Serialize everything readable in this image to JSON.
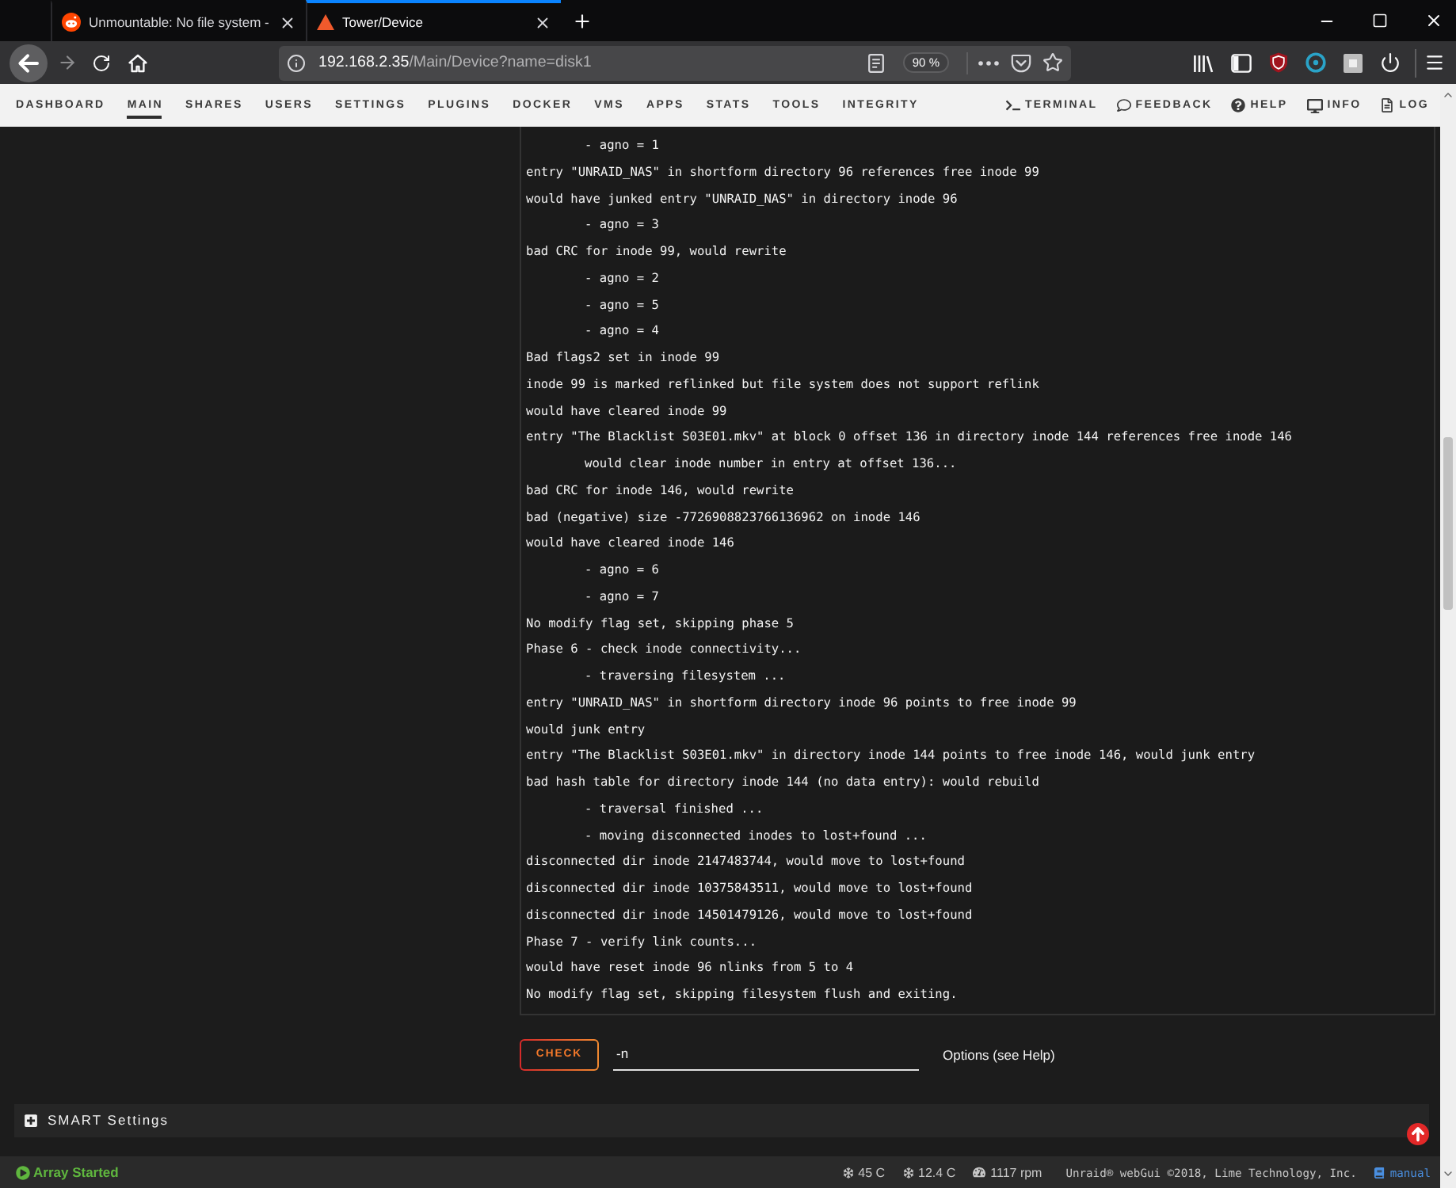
{
  "browser": {
    "tabs": [
      {
        "title": "Unmountable: No file system -",
        "selected": false
      },
      {
        "title": "Tower/Device",
        "selected": true
      }
    ],
    "url": {
      "host": "192.168.2.35",
      "path": "/Main/Device?name=disk1"
    },
    "zoom": "90 %"
  },
  "nav": {
    "items": [
      {
        "label": "DASHBOARD",
        "selected": false
      },
      {
        "label": "MAIN",
        "selected": true
      },
      {
        "label": "SHARES",
        "selected": false
      },
      {
        "label": "USERS",
        "selected": false
      },
      {
        "label": "SETTINGS",
        "selected": false
      },
      {
        "label": "PLUGINS",
        "selected": false
      },
      {
        "label": "DOCKER",
        "selected": false
      },
      {
        "label": "VMS",
        "selected": false
      },
      {
        "label": "APPS",
        "selected": false
      },
      {
        "label": "STATS",
        "selected": false
      },
      {
        "label": "TOOLS",
        "selected": false
      },
      {
        "label": "INTEGRITY",
        "selected": false
      }
    ],
    "tools": [
      "TERMINAL",
      "FEEDBACK",
      "HELP",
      "INFO",
      "LOG"
    ]
  },
  "log": {
    "lines": [
      {
        "children": [
          {
            "text": "- agno = 1"
          }
        ]
      },
      {
        "text": "entry \"UNRAID_NAS\" in shortform directory 96 references free inode 99"
      },
      {
        "text": "would have junked entry \"UNRAID_NAS\" in directory inode 96",
        "children": [
          {
            "text": "- agno = 3"
          }
        ]
      },
      {
        "text": "bad CRC for inode 99, would rewrite",
        "children": [
          {
            "text": "- agno = 2"
          },
          {
            "text": "- agno = 5"
          },
          {
            "text": "- agno = 4"
          }
        ]
      },
      {
        "text": "Bad flags2 set in inode 99"
      },
      {
        "text": "inode 99 is marked reflinked but file system does not support reflink"
      },
      {
        "text": "would have cleared inode 99"
      },
      {
        "text": "entry \"The Blacklist S03E01.mkv\" at block 0 offset 136 in directory inode 144 references free inode 146",
        "children": [
          {
            "text": "would clear inode number in entry at offset 136..."
          }
        ]
      },
      {
        "text": "bad CRC for inode 146, would rewrite"
      },
      {
        "text": "bad (negative) size -7726908823766136962 on inode 146"
      },
      {
        "text": "would have cleared inode 146",
        "children": [
          {
            "text": "- agno = 6"
          },
          {
            "text": "- agno = 7"
          }
        ]
      },
      {
        "text": "No modify flag set, skipping phase 5"
      },
      {
        "text": "Phase 6 - check inode connectivity...",
        "children": [
          {
            "text": "- traversing filesystem ..."
          }
        ]
      },
      {
        "text": "entry \"UNRAID_NAS\" in shortform directory inode 96 points to free inode 99"
      },
      {
        "text": "would junk entry"
      },
      {
        "text": "entry \"The Blacklist S03E01.mkv\" in directory inode 144 points to free inode 146, would junk entry"
      },
      {
        "text": "bad hash table for directory inode 144 (no data entry): would rebuild",
        "children": [
          {
            "text": "- traversal finished ..."
          },
          {
            "text": "- moving disconnected inodes to lost+found ..."
          }
        ]
      },
      {
        "text": "disconnected dir inode 2147483744, would move to lost+found"
      },
      {
        "text": "disconnected dir inode 10375843511, would move to lost+found"
      },
      {
        "text": "disconnected dir inode 14501479126, would move to lost+found"
      },
      {
        "text": "Phase 7 - verify link counts..."
      },
      {
        "text": "would have reset inode 96 nlinks from 5 to 4"
      },
      {
        "text": "No modify flag set, skipping filesystem flush and exiting."
      }
    ]
  },
  "check": {
    "button": "CHECK",
    "options": {
      "value": "-n"
    },
    "hint": "Options (see Help)"
  },
  "smart_settings": {
    "label": "SMART Settings",
    "expanded": false
  },
  "status_bar": {
    "array_status": "Array Started",
    "readings": [
      "45 C",
      "12.4 C",
      "1117 rpm"
    ],
    "copyright": "Unraid® webGui ©2018, Lime Technology, Inc.",
    "manual_link": "manual"
  }
}
